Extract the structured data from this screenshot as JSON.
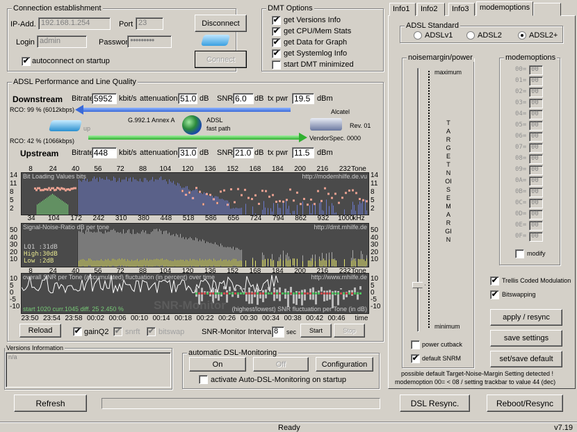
{
  "connection": {
    "title": "Connection establishment",
    "ip_label": "IP-Add.",
    "ip": "192.168.1.254",
    "port_label": "Port",
    "port": "23",
    "login_label": "Login",
    "login": "admin",
    "password_label": "Password",
    "password": "●●●●●●●●●",
    "autoconnect": "autoconnect on startup",
    "autoconnect_checked": true,
    "disconnect": "Disconnect",
    "connect": "Connect"
  },
  "dmt": {
    "title": "DMT Options",
    "options": [
      {
        "label": "get Versions Info",
        "checked": true
      },
      {
        "label": "get CPU/Mem Stats",
        "checked": true
      },
      {
        "label": "get Data for Graph",
        "checked": true
      },
      {
        "label": "get Systemlog Info",
        "checked": true
      },
      {
        "label": "start DMT minimized",
        "checked": false
      }
    ]
  },
  "adsl": {
    "title": "ADSL Performance and Line Quality",
    "downstream": {
      "label": "Downstream",
      "bitrate_label": "Bitrate",
      "bitrate": "5952",
      "bitrate_unit": "kbit/s",
      "att_label": "attenuation",
      "att": "51.0",
      "att_unit": "dB",
      "snr_label": "SNR",
      "snr": "6.0",
      "snr_unit": "dB",
      "txpwr_label": "tx pwr",
      "txpwr": "19.5",
      "txpwr_unit": "dBm",
      "rco": "RCO: 99 % (6012kbps)"
    },
    "upstream": {
      "label": "Upstream",
      "bitrate_label": "Bitrate",
      "bitrate": "448",
      "bitrate_unit": "kbit/s",
      "att_label": "attenuation",
      "att": "31.0",
      "att_unit": "dB",
      "snr_label": "SNR",
      "snr": "21.0",
      "snr_unit": "dB",
      "txpwr_label": "tx pwr",
      "txpwr": "11.5",
      "txpwr_unit": "dBm",
      "rco": "RCO: 42 % (1066kbps)"
    },
    "mode": "G.992.1 Annex A",
    "type1": "ADSL",
    "type2": "fast path",
    "up": "up",
    "vendor": "Alcatel",
    "rev": "Rev. 01",
    "vendorspec": "VendorSpec. 0000",
    "colors": {
      "downstream_arrow": "#4a7ee0",
      "upstream_arrow": "#40c040"
    }
  },
  "graphs": {
    "tone_ticks": [
      "8",
      "24",
      "40",
      "56",
      "72",
      "88",
      "104",
      "120",
      "136",
      "152",
      "168",
      "184",
      "200",
      "216",
      "232",
      "Tone"
    ],
    "khz_ticks": [
      "34",
      "104",
      "172",
      "242",
      "310",
      "380",
      "448",
      "518",
      "586",
      "656",
      "724",
      "794",
      "862",
      "932",
      "1000",
      "kHz"
    ],
    "time_ticks": [
      "23:50",
      "23:54",
      "23:58",
      "00:02",
      "00:06",
      "00:10",
      "00:14",
      "00:18",
      "00:22",
      "00:26",
      "00:30",
      "00:34",
      "00:38",
      "00:42",
      "00:46",
      "time"
    ],
    "bits_y": [
      "14",
      "11",
      "8",
      "5",
      "2"
    ],
    "snr_y": [
      "50",
      "40",
      "30",
      "20",
      "10"
    ],
    "mon_y": [
      "10",
      "5",
      "0",
      "-5",
      "-10"
    ],
    "bits_title": "Bit Loading Values  bits",
    "bits_url": "http://modemhilfe.de.vu",
    "snr_title": "Signal-Noise-Ratio   dB per tone",
    "snr_url": "http://dmt.mhilfe.de",
    "lq1": "LQ1  :31dB",
    "high": "High:30dB",
    "low": "Low  :2dB",
    "mon_title": "overall SNR per Tone (accumulated) fluctuation (in percent) over time",
    "mon_url": "http://www.mhilfe.de",
    "mon_stats": "start 1020   curr.1045    diff. 25       2.450 %",
    "mon_watermark": "SNR-Monitor",
    "mon_foot": "(highest/lowest) SNR fluctuation per Tone (in dB)"
  },
  "controls": {
    "reload": "Reload",
    "gainq2": "gainQ2",
    "snrft": "snrft",
    "bitswap": "bitswap",
    "interval_label": "SNR-Monitor Interval:",
    "interval": "8",
    "sec": "sec",
    "start": "Start",
    "stop": "Stop"
  },
  "versions": {
    "title": "Versions Information",
    "text": "n/a"
  },
  "monitoring": {
    "title": "automatic DSL-Monitoring",
    "on": "On",
    "off": "Off",
    "config": "Configuration",
    "activate": "activate Auto-DSL-Monitoring on startup"
  },
  "bottom": {
    "refresh": "Refresh",
    "progress": 0,
    "resync": "DSL Resync.",
    "reboot": "Reboot/Resync"
  },
  "status": {
    "text": "Ready",
    "version": "v7.19"
  },
  "tabs": [
    "Info1",
    "Info2",
    "Info3",
    "modemoptions",
    ""
  ],
  "right": {
    "std_title": "ADSL Standard",
    "standards": [
      "ADSLv1",
      "ADSL2",
      "ADSL2+"
    ],
    "selected": "ADSL2+",
    "nm_title": "noisemargin/power",
    "maximum": "maximum",
    "minimum": "minimum",
    "vertical": "TARGET NOISE MARGIN",
    "slider_level_dec": 44,
    "power_cutback": "power cutback",
    "default_snrm": "default SNRM",
    "mo_title": "modemoptions",
    "mo_rows": [
      [
        "00=",
        "00"
      ],
      [
        "01=",
        "00"
      ],
      [
        "02=",
        "00"
      ],
      [
        "03=",
        "00"
      ],
      [
        "04=",
        "00"
      ],
      [
        "05=",
        "00"
      ],
      [
        "06=",
        "00"
      ],
      [
        "07=",
        "00"
      ],
      [
        "08=",
        "00"
      ],
      [
        "09=",
        "00"
      ],
      [
        "0A=",
        "00"
      ],
      [
        "0B=",
        "00"
      ],
      [
        "0C=",
        "00"
      ],
      [
        "0D=",
        "00"
      ],
      [
        "0E=",
        "00"
      ],
      [
        "0F=",
        "00"
      ]
    ],
    "modify": "modify",
    "trellis": "Trellis Coded Modulation",
    "bitswapping": "Bitswapping",
    "apply": "apply / resync",
    "save": "save settings",
    "setdefault": "set/save default",
    "notice1": "possible default Target-Noise-Margin Setting detected !",
    "notice2": "modemoption 00= < 08  / setting trackbar to value 44 (dec)"
  }
}
